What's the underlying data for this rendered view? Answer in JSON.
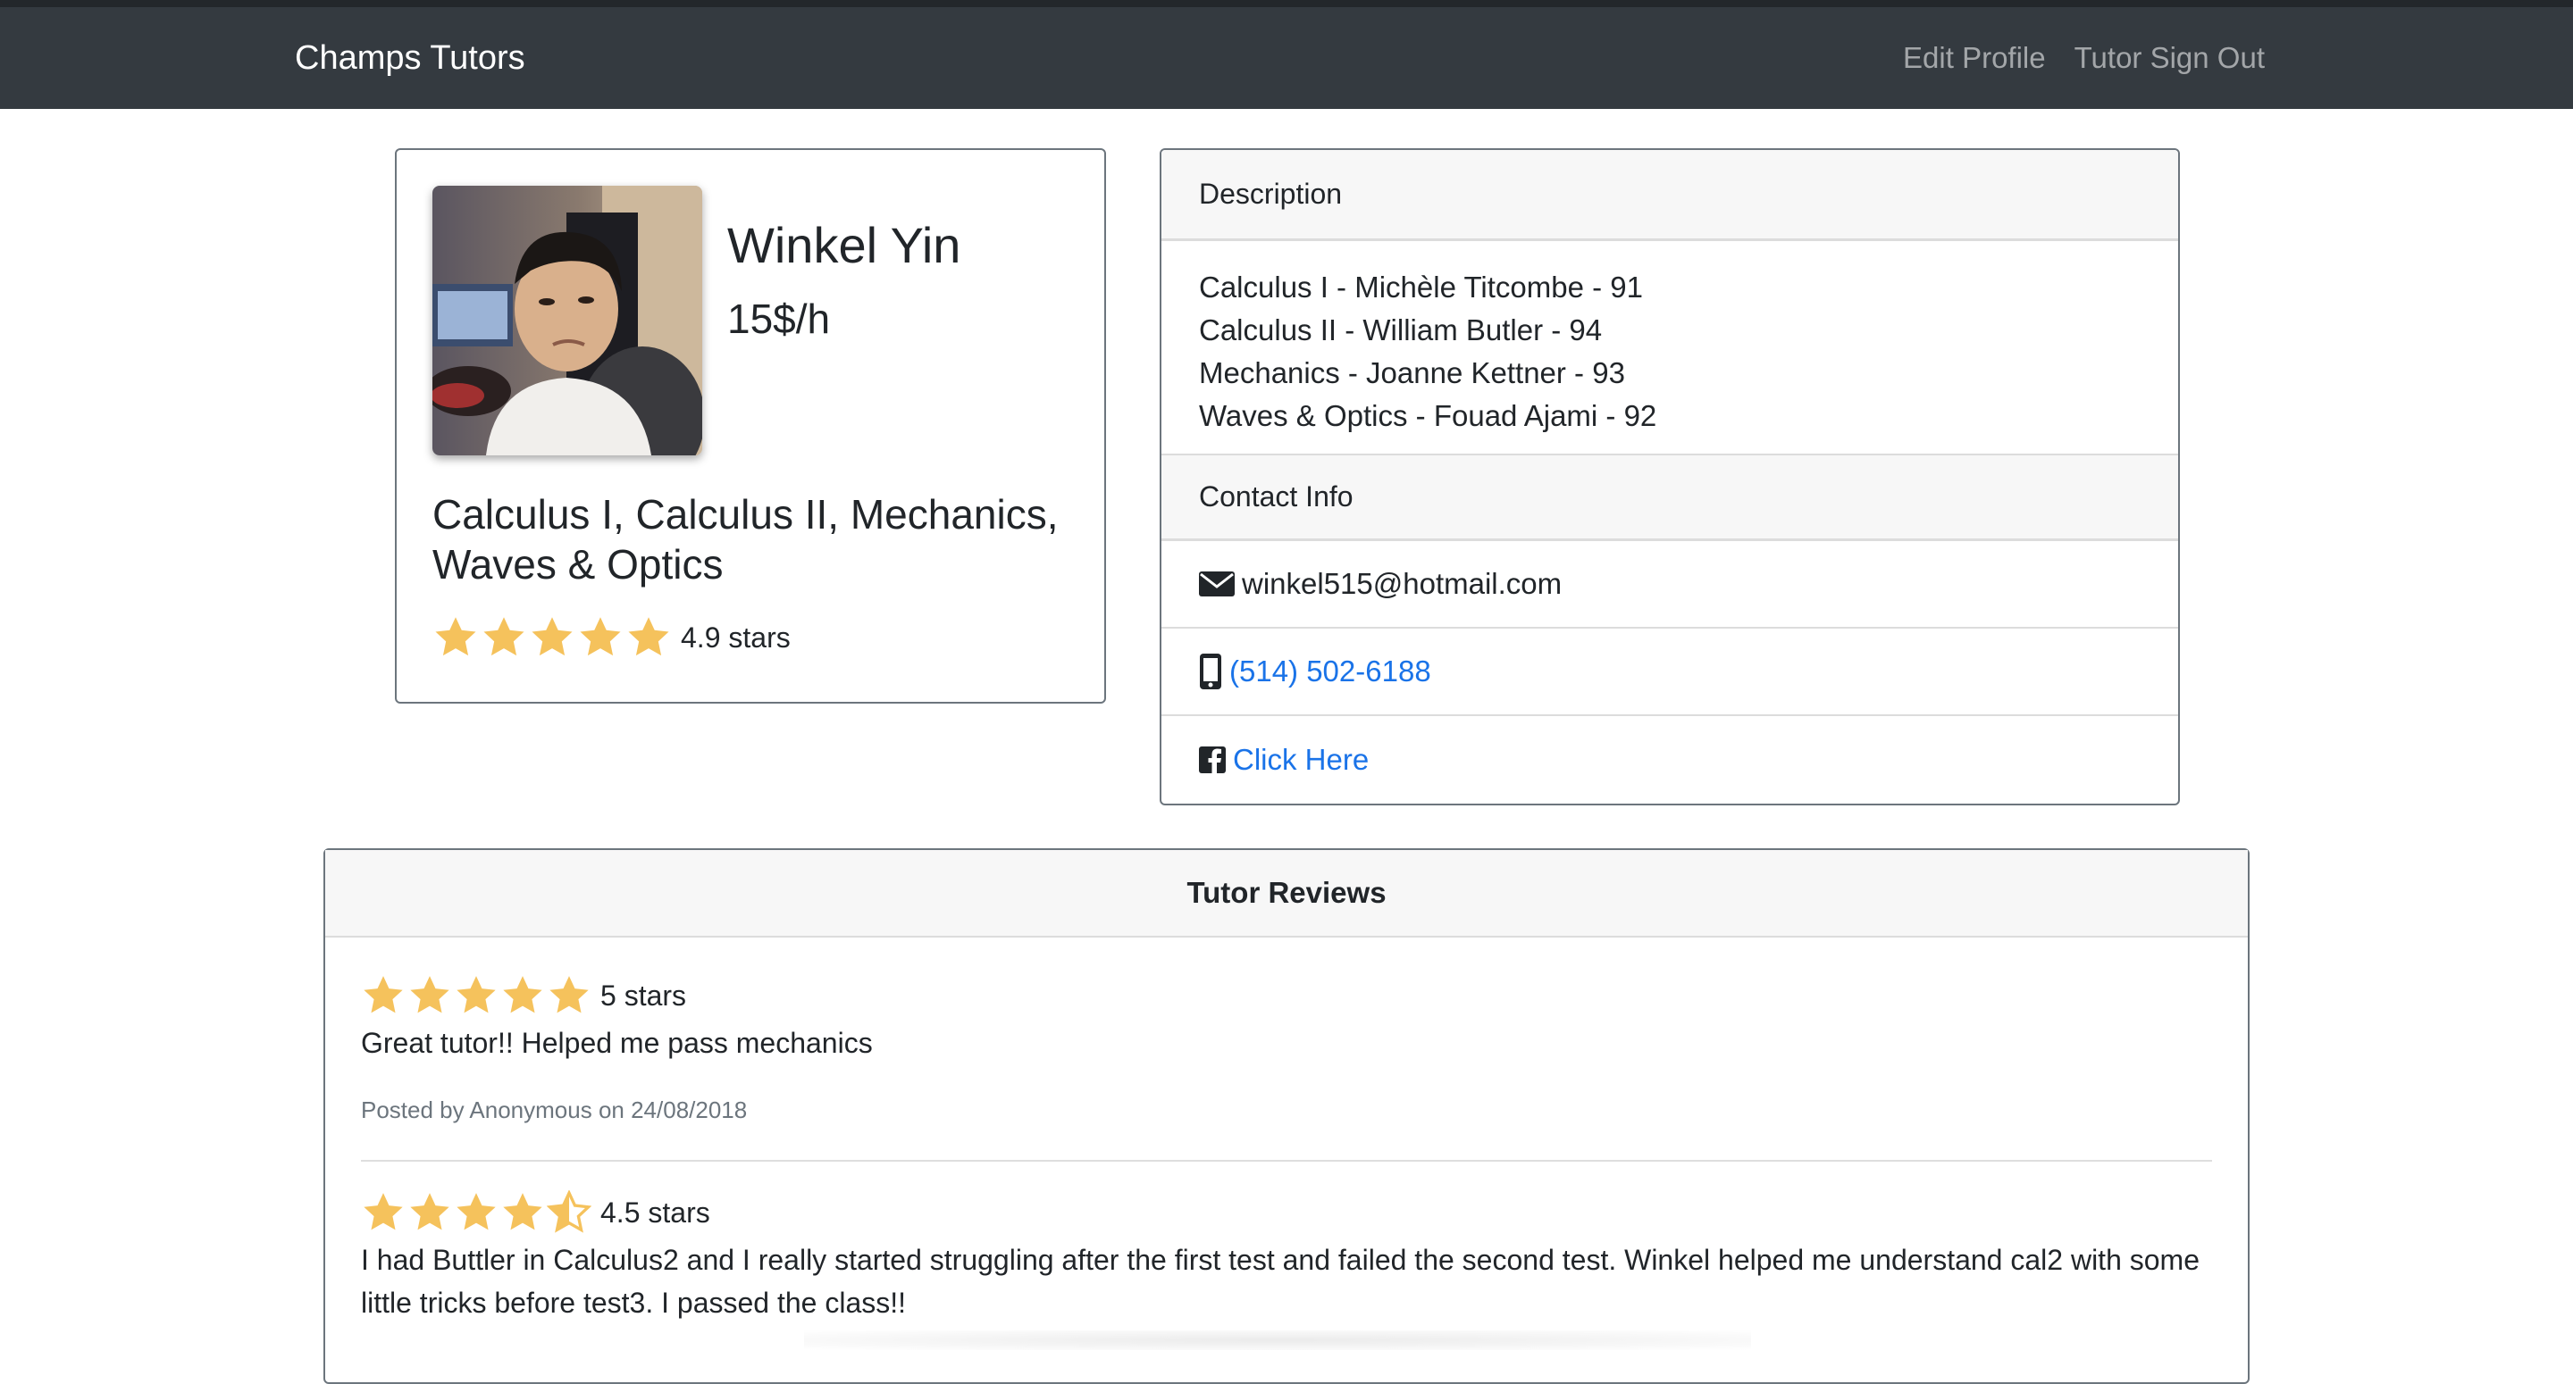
{
  "navbar": {
    "brand": "Champs Tutors",
    "links": [
      "Edit Profile",
      "Tutor Sign Out"
    ]
  },
  "profile": {
    "name": "Winkel Yin",
    "rate": "15$/h",
    "subjects": "Calculus I, Calculus II, Mechanics, Waves & Optics",
    "rating": 4.9,
    "rating_text": "4.9 stars"
  },
  "description": {
    "header": "Description",
    "lines": [
      "Calculus I - Michèle Titcombe - 91",
      "Calculus II - William Butler - 94",
      "Mechanics - Joanne Kettner - 93",
      "Waves & Optics - Fouad Ajami - 92"
    ]
  },
  "contact": {
    "header": "Contact Info",
    "email": "winkel515@hotmail.com",
    "phone": "(514) 502-6188",
    "facebook": "Click Here",
    "icons": [
      "envelope-icon",
      "mobile-phone-icon",
      "facebook-icon"
    ]
  },
  "reviews": {
    "header": "Tutor Reviews",
    "items": [
      {
        "rating": 5,
        "rating_text": "5 stars",
        "text": "Great tutor!! Helped me pass mechanics",
        "meta": "Posted by Anonymous on 24/08/2018"
      },
      {
        "rating": 4.5,
        "rating_text": "4.5 stars",
        "text": "I had Buttler in Calculus2 and I really started struggling after the first test and failed the second test. Winkel helped me understand cal2 with some little tricks before test3. I passed the class!!",
        "meta": ""
      }
    ]
  },
  "colors": {
    "navbar": "#343a40",
    "star": "#f5c25c",
    "link": "#1a73e8"
  }
}
